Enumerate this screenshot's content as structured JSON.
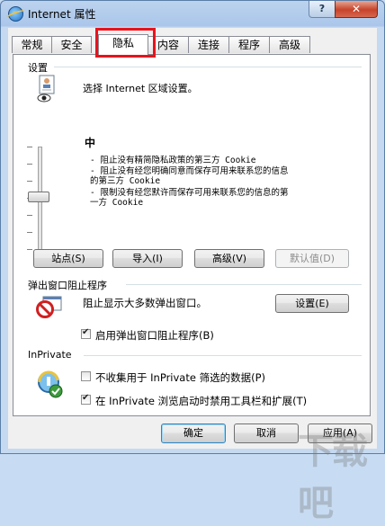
{
  "window": {
    "title": "Internet 属性",
    "help_label": "?",
    "close_label": "✕"
  },
  "tabs": [
    {
      "label": "常规",
      "active": false
    },
    {
      "label": "安全",
      "active": false
    },
    {
      "label": "隐私",
      "active": true
    },
    {
      "label": "内容",
      "active": false
    },
    {
      "label": "连接",
      "active": false
    },
    {
      "label": "程序",
      "active": false
    },
    {
      "label": "高级",
      "active": false
    }
  ],
  "settings": {
    "group_label": "设置",
    "instruction": "选择 Internet 区域设置。",
    "level": "中",
    "descriptions": [
      "- 阻止没有精简隐私政策的第三方 Cookie",
      "- 阻止没有经您明确同意而保存可用来联系您的信息",
      "的第三方 Cookie",
      "- 限制没有经您默许而保存可用来联系您的信息的第",
      "一方 Cookie"
    ],
    "buttons": {
      "sites": "站点(S)",
      "import": "导入(I)",
      "advanced": "高级(V)",
      "default": "默认值(D)"
    }
  },
  "popup": {
    "group_label": "弹出窗口阻止程序",
    "description": "阻止显示大多数弹出窗口。",
    "settings_button": "设置(E)",
    "enable_label": "启用弹出窗口阻止程序(B)",
    "enabled": true
  },
  "inprivate": {
    "group_label": "InPrivate",
    "filter_label": "不收集用于 InPrivate 筛选的数据(P)",
    "filter_checked": false,
    "disable_label": "在 InPrivate 浏览启动时禁用工具栏和扩展(T)",
    "disable_checked": true
  },
  "footer": {
    "ok": "确定",
    "cancel": "取消",
    "apply": "应用(A)"
  },
  "watermark": "下载吧",
  "colors": {
    "highlight": "#e8131b",
    "window_frame": "#aac6ea"
  }
}
